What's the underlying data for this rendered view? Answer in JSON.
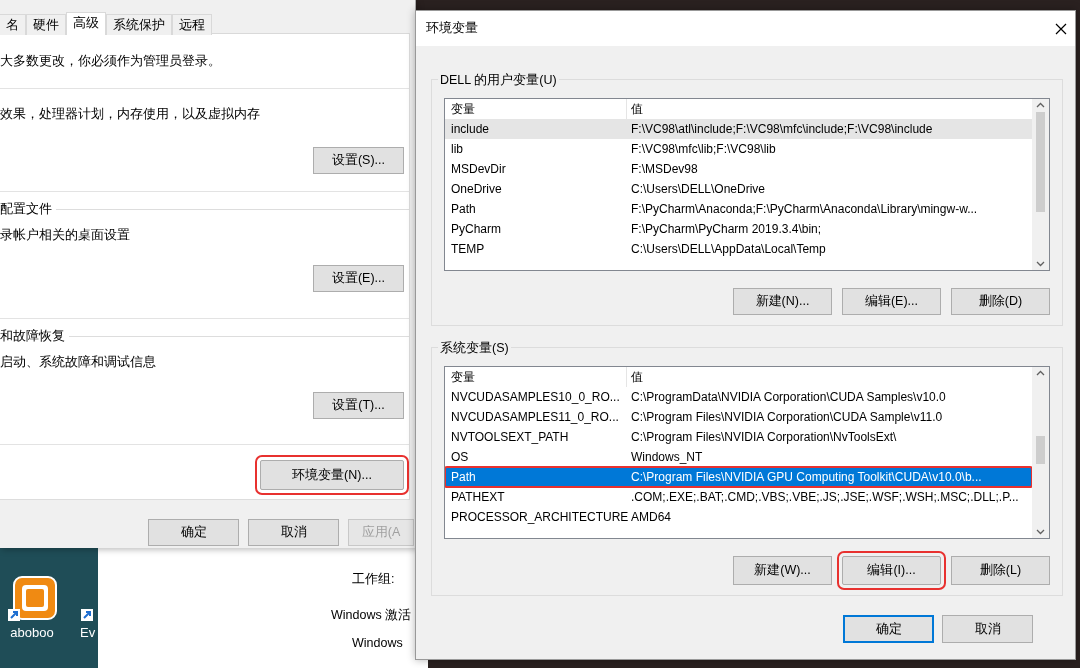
{
  "desktop": {
    "icons": [
      {
        "label": "aboboo"
      },
      {
        "label": "Ev"
      }
    ]
  },
  "background_window": {
    "lines": [
      "工作组:",
      "Windows 激活",
      "Windows"
    ]
  },
  "system_properties": {
    "tabs": [
      {
        "label": "名",
        "selected": false
      },
      {
        "label": "硬件",
        "selected": false
      },
      {
        "label": "高级",
        "selected": true
      },
      {
        "label": "系统保护",
        "selected": false
      },
      {
        "label": "远程",
        "selected": false
      }
    ],
    "sections": [
      {
        "description": "大多数更改，你必须作为管理员登录。"
      },
      {
        "description": "效果，处理器计划，内存使用，以及虚拟内存",
        "button": "设置(S)..."
      },
      {
        "legend": "配置文件",
        "description": "录帐户相关的桌面设置",
        "button": "设置(E)..."
      },
      {
        "legend": "和故障恢复",
        "description": "启动、系统故障和调试信息",
        "button": "设置(T)..."
      }
    ],
    "env_button": {
      "label": "环境变量(N)...",
      "framed": true
    },
    "footer_buttons": [
      {
        "label": "确定",
        "disabled": false
      },
      {
        "label": "取消",
        "disabled": false
      },
      {
        "label": "应用(A",
        "disabled": true
      }
    ]
  },
  "env_dialog": {
    "title": "环境变量",
    "groups": [
      {
        "legend": "DELL 的用户变量(U)",
        "columns": [
          "变量",
          "值"
        ],
        "rows": [
          {
            "name": "include",
            "value": "F:\\VC98\\atl\\include;F:\\VC98\\mfc\\include;F:\\VC98\\include",
            "selected": false,
            "hovered": true,
            "framed": false
          },
          {
            "name": "lib",
            "value": "F:\\VC98\\mfc\\lib;F:\\VC98\\lib",
            "selected": false,
            "hovered": false,
            "framed": false
          },
          {
            "name": "MSDevDir",
            "value": "F:\\MSDev98",
            "selected": false,
            "hovered": false,
            "framed": false
          },
          {
            "name": "OneDrive",
            "value": "C:\\Users\\DELL\\OneDrive",
            "selected": false,
            "hovered": false,
            "framed": false
          },
          {
            "name": "Path",
            "value": "F:\\PyCharm\\Anaconda;F:\\PyCharm\\Anaconda\\Library\\mingw-w...",
            "selected": false,
            "hovered": false,
            "framed": false
          },
          {
            "name": "PyCharm",
            "value": "F:\\PyCharm\\PyCharm 2019.3.4\\bin;",
            "selected": false,
            "hovered": false,
            "framed": false
          },
          {
            "name": "TEMP",
            "value": "C:\\Users\\DELL\\AppData\\Local\\Temp",
            "selected": false,
            "hovered": false,
            "framed": false
          }
        ],
        "buttons": [
          {
            "label": "新建(N)...",
            "framed": false
          },
          {
            "label": "编辑(E)...",
            "framed": false
          },
          {
            "label": "删除(D)",
            "framed": false
          }
        ]
      },
      {
        "legend": "系统变量(S)",
        "columns": [
          "变量",
          "值"
        ],
        "rows": [
          {
            "name": "NVCUDASAMPLES10_0_RO...",
            "value": "C:\\ProgramData\\NVIDIA Corporation\\CUDA Samples\\v10.0",
            "selected": false,
            "hovered": false,
            "framed": false
          },
          {
            "name": "NVCUDASAMPLES11_0_RO...",
            "value": "C:\\Program Files\\NVIDIA Corporation\\CUDA Sample\\v11.0",
            "selected": false,
            "hovered": false,
            "framed": false
          },
          {
            "name": "NVTOOLSEXT_PATH",
            "value": "C:\\Program Files\\NVIDIA Corporation\\NvToolsExt\\",
            "selected": false,
            "hovered": false,
            "framed": false
          },
          {
            "name": "OS",
            "value": "Windows_NT",
            "selected": false,
            "hovered": false,
            "framed": false
          },
          {
            "name": "Path",
            "value": "C:\\Program Files\\NVIDIA GPU Computing Toolkit\\CUDA\\v10.0\\b...",
            "selected": true,
            "hovered": false,
            "framed": true
          },
          {
            "name": "PATHEXT",
            "value": ".COM;.EXE;.BAT;.CMD;.VBS;.VBE;.JS;.JSE;.WSF;.WSH;.MSC;.DLL;.P...",
            "selected": false,
            "hovered": false,
            "framed": false
          },
          {
            "name": "PROCESSOR_ARCHITECTURE",
            "value": "AMD64",
            "selected": false,
            "hovered": false,
            "framed": false
          }
        ],
        "buttons": [
          {
            "label": "新建(W)...",
            "framed": false
          },
          {
            "label": "编辑(I)...",
            "framed": true
          },
          {
            "label": "删除(L)",
            "framed": false
          }
        ]
      }
    ],
    "footer_buttons": [
      {
        "label": "确定",
        "default": true
      },
      {
        "label": "取消",
        "default": false
      }
    ]
  }
}
